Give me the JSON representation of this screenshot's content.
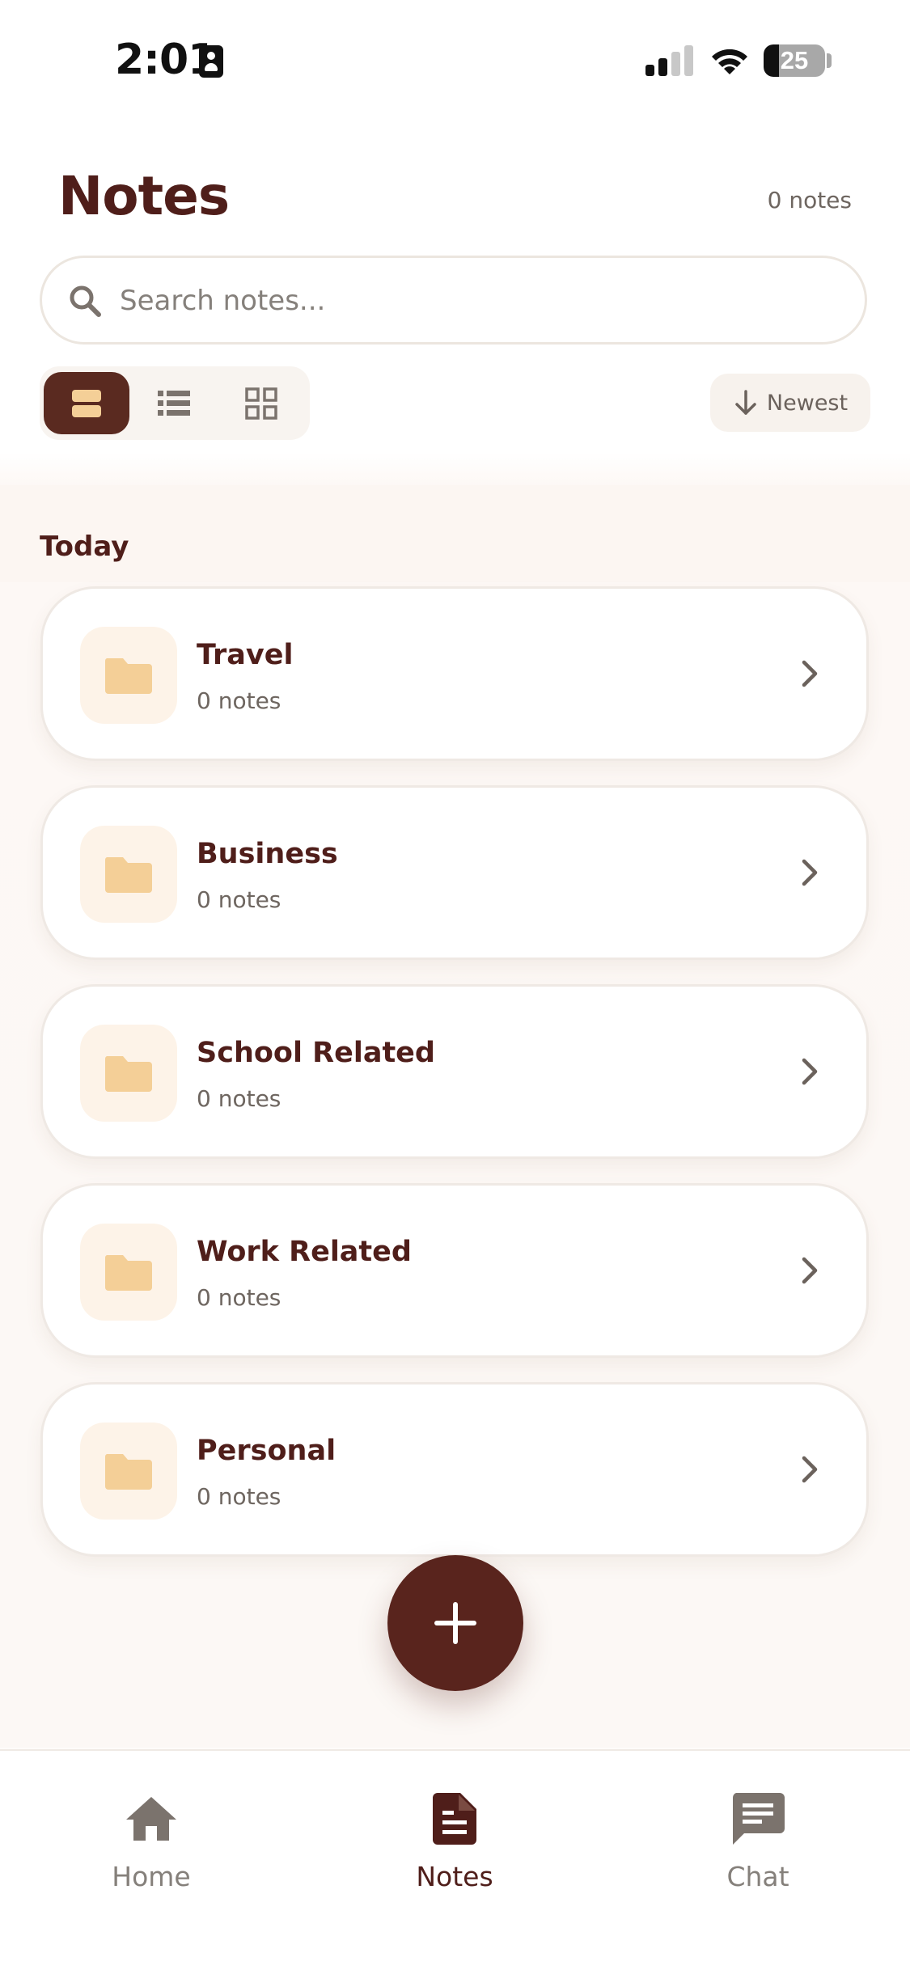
{
  "status_bar": {
    "time": "2:01",
    "battery": "25",
    "battery_level": 0.25
  },
  "header": {
    "title": "Notes",
    "count": "0 notes"
  },
  "search": {
    "placeholder": "Search notes..."
  },
  "view_toggle": {
    "options": [
      "card-view-icon",
      "list-view-icon",
      "grid-view-icon"
    ],
    "selected": "card-view-icon"
  },
  "sort": {
    "label": "Newest",
    "icon": "arrow-down-icon"
  },
  "section": {
    "title": "Today"
  },
  "folders": [
    {
      "name": "Travel",
      "count": "0 notes"
    },
    {
      "name": "Business",
      "count": "0 notes"
    },
    {
      "name": "School Related",
      "count": "0 notes"
    },
    {
      "name": "Work Related",
      "count": "0 notes"
    },
    {
      "name": "Personal",
      "count": "0 notes"
    }
  ],
  "fab": {
    "icon": "plus-icon"
  },
  "tab_bar": {
    "items": [
      {
        "label": "Home",
        "icon": "home-icon"
      },
      {
        "label": "Notes",
        "icon": "document-icon"
      },
      {
        "label": "Chat",
        "icon": "chat-icon"
      }
    ],
    "active": "Notes"
  },
  "colors": {
    "primary": "#59241d",
    "title_text": "#4f1e1a",
    "muted_text": "#85807b",
    "folder_icon": "#f4cf97",
    "folder_bg": "#fdf3e8"
  }
}
